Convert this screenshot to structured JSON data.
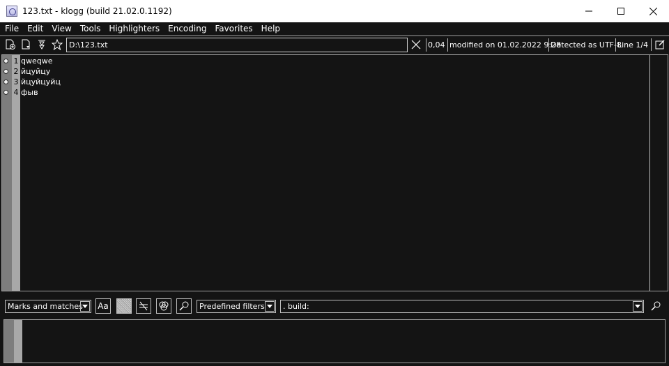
{
  "window": {
    "title": "123.txt - klogg (build 21.02.0.1192)"
  },
  "menu": [
    "File",
    "Edit",
    "View",
    "Tools",
    "Highlighters",
    "Encoding",
    "Favorites",
    "Help"
  ],
  "toolbar": {
    "file_path": "D:\\123.txt",
    "file_size": "0,04",
    "modified": "modified on 01.02.2022 9:28",
    "encoding": "Detected as UTF-8",
    "line_info": "Line 1/4"
  },
  "log_lines": [
    {
      "number": "1",
      "text": "qweqwe"
    },
    {
      "number": "2",
      "text": "йцуйцу"
    },
    {
      "number": "3",
      "text": "йцуйцуйц"
    },
    {
      "number": "4",
      "text": "фыв"
    }
  ],
  "filter": {
    "visibility_mode": "Marks and matches",
    "case_button_label": "Aa",
    "predefined_filters": "Predefined filters",
    "search_text": ". build:"
  },
  "icons": {
    "open": "open-file-icon",
    "reload": "reload-icon",
    "follow": "follow-icon",
    "favorite": "star-icon",
    "clear": "close-icon",
    "edit": "edit-icon",
    "search": "search-icon"
  },
  "colors": {
    "background": "#141414",
    "gutter_marks": "#7d7d7d",
    "gutter_numbers": "#a8a8a8",
    "text": "#ffffff"
  }
}
